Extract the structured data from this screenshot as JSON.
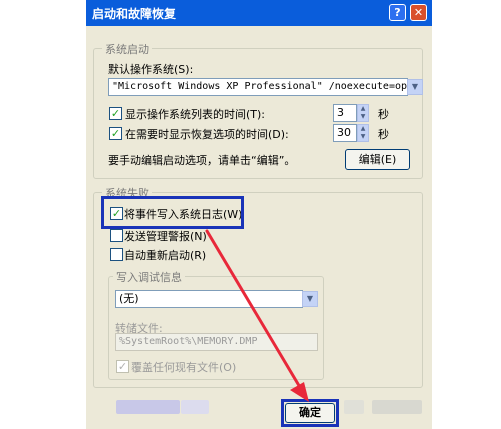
{
  "window": {
    "title": "启动和故障恢复",
    "help_label": "?",
    "close_label": "✕"
  },
  "startup": {
    "group_label": "系统启动",
    "default_os_label": "默认操作系统(S):",
    "default_os_value": "\"Microsoft Windows XP Professional\" /noexecute=optin",
    "show_list_label": "显示操作系统列表的时间(T):",
    "show_list_checked": true,
    "show_list_value": "3",
    "show_recovery_label": "在需要时显示恢复选项的时间(D):",
    "show_recovery_checked": true,
    "show_recovery_value": "30",
    "seconds_label": "秒",
    "edit_hint": "要手动编辑启动选项，请单击“编辑”。",
    "edit_button": "编辑(E)"
  },
  "failure": {
    "group_label": "系统失败",
    "write_event_label": "将事件写入系统日志(W)",
    "write_event_checked": true,
    "send_alert_label": "发送管理警报(N)",
    "send_alert_checked": false,
    "auto_restart_label": "自动重新启动(R)",
    "auto_restart_checked": false
  },
  "debug": {
    "group_label": "写入调试信息",
    "type_value": "(无)",
    "dump_file_label": "转储文件:",
    "dump_file_value": "%SystemRoot%\\MEMORY.DMP",
    "overwrite_label": "覆盖任何现有文件(O)",
    "overwrite_checked": true
  },
  "footer": {
    "ok_button": "确定"
  },
  "colors": {
    "annotation_box": "#1933b8",
    "annotation_arrow": "#e8283a",
    "titlebar": "#0a5ddb"
  },
  "icons": {
    "check": "✓",
    "dropdown": "▼",
    "spin_up": "▲",
    "spin_down": "▼"
  }
}
